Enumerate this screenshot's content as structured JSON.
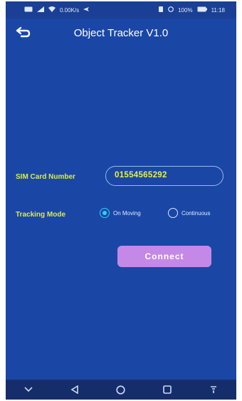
{
  "status_bar": {
    "left_text": "0.00K/s",
    "right_text": "100%",
    "time": "11:18"
  },
  "app_bar": {
    "title": "Object Tracker V1.0",
    "back_icon": "back-arrow-icon"
  },
  "form": {
    "sim_label": "SIM Card Number",
    "sim_value": "01554565292",
    "mode_label": "Tracking Mode",
    "modes": [
      {
        "label": "On Moving",
        "selected": true
      },
      {
        "label": "Continuous",
        "selected": false
      }
    ],
    "connect_label": "Connect"
  },
  "nav_bar": {
    "icons": [
      "chevron-down-icon",
      "back-triangle-icon",
      "home-circle-icon",
      "recents-square-icon",
      "notification-icon"
    ]
  },
  "colors": {
    "background": "#1a47a6",
    "label": "#dce94a",
    "accent": "#2fd0f0",
    "button": "#c489e6"
  }
}
